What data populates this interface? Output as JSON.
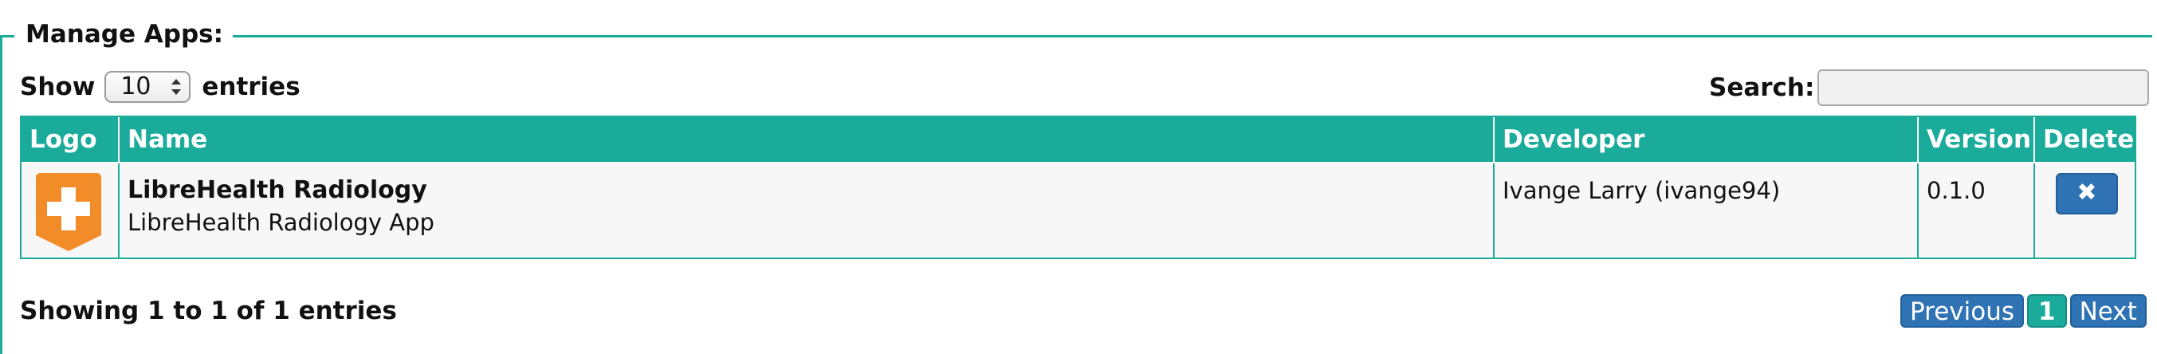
{
  "panel": {
    "title": "Manage Apps:"
  },
  "length_menu": {
    "show_label": "Show",
    "selected": "10",
    "entries_label": "entries"
  },
  "search": {
    "label": "Search:",
    "value": ""
  },
  "table": {
    "headers": {
      "logo": "Logo",
      "name": "Name",
      "developer": "Developer",
      "version": "Version",
      "delete": "Delete"
    },
    "rows": [
      {
        "logo_icon": "orange-plus-badge-icon",
        "name": "LibreHealth Radiology",
        "description": "LibreHealth Radiology App",
        "developer": "Ivange Larry (ivange94)",
        "version": "0.1.0",
        "delete_icon": "close-icon",
        "delete_glyph": "✖"
      }
    ]
  },
  "info": "Showing 1 to 1 of 1 entries",
  "pagination": {
    "previous": "Previous",
    "current": "1",
    "next": "Next"
  },
  "colors": {
    "accent": "#1aab9b",
    "button_blue": "#2f73b4",
    "logo_orange": "#f28c28"
  }
}
